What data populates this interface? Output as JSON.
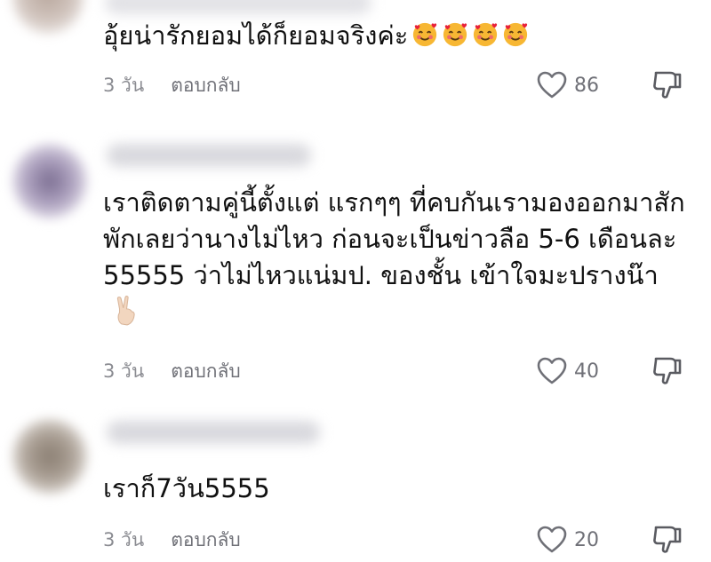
{
  "comments": [
    {
      "text": "อุ้ยน่ารักยอมได้ก็ยอมจริงค่ะ",
      "time": "3 วัน",
      "reply_label": "ตอบกลับ",
      "likes": "86"
    },
    {
      "text": "เราติดตามคู่นี้ตั้งแต่ แรกๆๆ ที่คบกันเรามองออกมาสักพักเลยว่านางไม่ไหว ก่อนจะเป็นข่าวลือ 5-6 เดือนละ 55555 ว่าไม่ไหวแน่มป. ของชั้น เข้าใจมะปรางน๊า",
      "time": "3 วัน",
      "reply_label": "ตอบกลับ",
      "likes": "40"
    },
    {
      "text": "เราก็7วัน5555",
      "time": "3 วัน",
      "reply_label": "ตอบกลับ",
      "likes": "20"
    }
  ],
  "icons": {
    "like": "heart-outline-icon",
    "dislike": "thumbs-down-icon",
    "emoji_1": "smiling-face-with-hearts-emoji",
    "emoji_2": "victory-hand-emoji"
  },
  "colors": {
    "text": "#111111",
    "meta": "#8a8b91",
    "icon": "#6f7077"
  }
}
